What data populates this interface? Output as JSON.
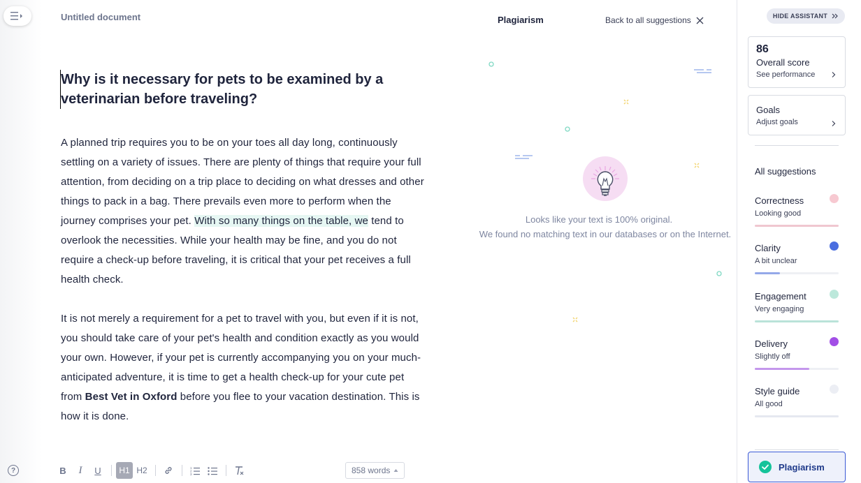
{
  "document": {
    "title": "Untitled document",
    "heading": "Why is it necessary for pets to be examined by a veterinarian before traveling?",
    "paragraph1": {
      "before": "A planned trip requires you to be on your toes all day long, continuously settling on a variety of issues. There are plenty of things that require your full attention, from deciding on a trip place to deciding on what dresses and other things to pack in a bag. There prevails even more to perform when the journey comprises your pet. ",
      "highlighted": "With so many things on the table, we",
      "after": " tend to overlook the necessities. While your health may be fine, and you do not require a check-up before traveling, it is critical that your pet receives a full health check."
    },
    "paragraph2": {
      "before": "It is not merely a requirement for a pet to travel with you, but even if it is not, you should take care of your pet's health and condition exactly as you would your own. However, if your pet is currently accompanying you on your much-anticipated adventure, it is time to get a health check-up for your cute pet from ",
      "bold": "Best Vet in Oxford",
      "after": " before you flee to your vacation destination. This is how it is done."
    }
  },
  "toolbar": {
    "bold": "B",
    "italic": "I",
    "underline": "U",
    "h1": "H1",
    "h2": "H2",
    "word_count": "858 words",
    "help": "?"
  },
  "plagiarism_panel": {
    "title": "Plagiarism",
    "back_link": "Back to all suggestions",
    "message_line1": "Looks like your text is 100% original.",
    "message_line2": "We found no matching text in our databases or on the Internet."
  },
  "sidebar": {
    "hide_label": "HIDE ASSISTANT",
    "score": {
      "value": "86",
      "label": "Overall score",
      "link": "See performance"
    },
    "goals": {
      "label": "Goals",
      "link": "Adjust goals"
    },
    "all_suggestions": "All suggestions",
    "categories": [
      {
        "name": "Correctness",
        "status": "Looking good",
        "color": "#f2a5b3",
        "level": 1.0
      },
      {
        "name": "Clarity",
        "status": "A bit unclear",
        "color": "#4a6ee0",
        "level": 0.3
      },
      {
        "name": "Engagement",
        "status": "Very engaging",
        "color": "#8fd9c3",
        "level": 1.0
      },
      {
        "name": "Delivery",
        "status": "Slightly off",
        "color": "#a24ee6",
        "level": 0.65
      },
      {
        "name": "Style guide",
        "status": "All good",
        "color": "#dfe2ec",
        "level": 1.0
      }
    ],
    "plagiarism_button": "Plagiarism"
  },
  "colors": {
    "accent": "#15c39a",
    "plagiarism_border": "#3b5ad6",
    "highlight": "#e6f7f3"
  }
}
